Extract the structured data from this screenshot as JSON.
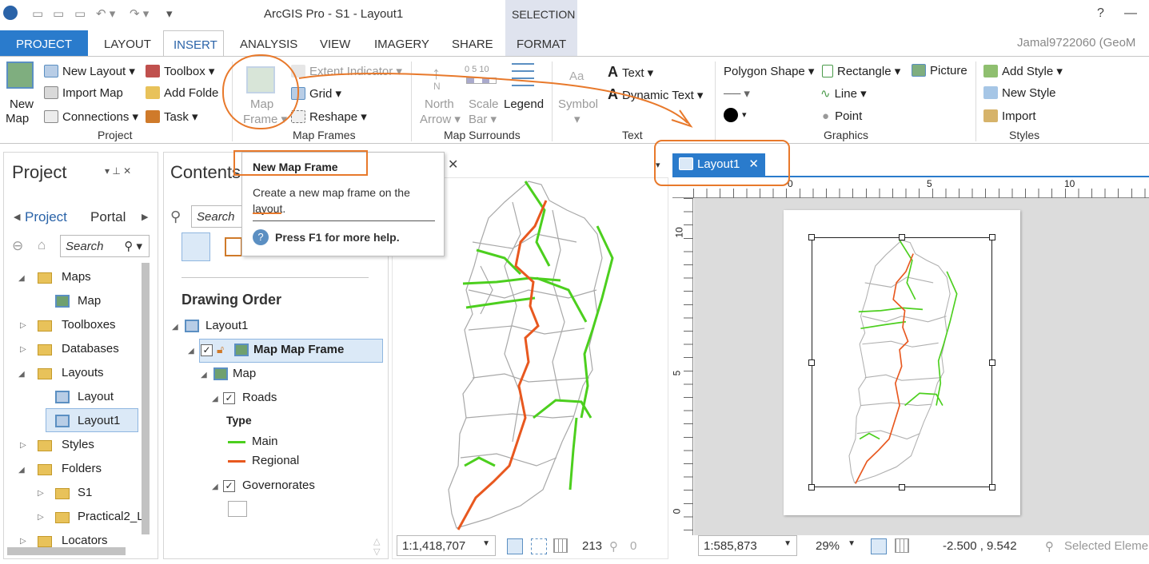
{
  "app": {
    "title": "ArcGIS Pro - S1 - Layout1",
    "contextual_header": "SELECTION",
    "user": "Jamal9722060 (GeoM"
  },
  "tabs": [
    "PROJECT",
    "LAYOUT",
    "INSERT",
    "ANALYSIS",
    "VIEW",
    "IMAGERY",
    "SHARE",
    "FORMAT"
  ],
  "ribbon": {
    "project": {
      "new_map": "New",
      "new_map2": "Map",
      "new_layout": "New Layout",
      "import_map": "Import Map",
      "connections": "Connections",
      "toolbox": "Toolbox",
      "add_folder": "Add Folde",
      "task": "Task",
      "group": "Project"
    },
    "map_frames": {
      "map_frame": "Map",
      "map_frame2": "Frame",
      "extent_indicator": "Extent Indicator",
      "grid": "Grid",
      "reshape": "Reshape",
      "group": "Map Frames"
    },
    "map_surrounds": {
      "north": "North",
      "north2": "Arrow",
      "scale": "Scale",
      "scale2": "Bar",
      "legend": "Legend",
      "scale_nums": "0 5 10",
      "group": "Map Surrounds"
    },
    "text": {
      "aa": "Aa",
      "symbol": "Symbol",
      "text": "Text",
      "dynamic_text": "Dynamic Text",
      "group": "Text"
    },
    "graphics": {
      "polygon_shape": "Polygon Shape",
      "rectangle": "Rectangle",
      "picture": "Picture",
      "line": "Line",
      "point": "Point",
      "group": "Graphics"
    },
    "styles": {
      "add_style": "Add Style",
      "new_style": "New Style",
      "import": "Import",
      "group": "Styles"
    }
  },
  "project_pane": {
    "title": "Project",
    "tabs": [
      "Project",
      "Portal"
    ],
    "search_placeholder": "Search",
    "items": [
      {
        "label": "Maps"
      },
      {
        "label": "Map"
      },
      {
        "label": "Toolboxes"
      },
      {
        "label": "Databases"
      },
      {
        "label": "Layouts"
      },
      {
        "label": "Layout"
      },
      {
        "label": "Layout1"
      },
      {
        "label": "Styles"
      },
      {
        "label": "Folders"
      },
      {
        "label": "S1"
      },
      {
        "label": "Practical2_L"
      },
      {
        "label": "Locators"
      }
    ]
  },
  "contents_pane": {
    "title": "Contents",
    "search_placeholder": "Search",
    "drawing_order": "Drawing Order",
    "items": {
      "layout1": "Layout1",
      "map_frame": "Map Map Frame",
      "map": "Map",
      "roads": "Roads",
      "type": "Type",
      "main": "Main",
      "regional": "Regional",
      "governorates": "Governorates"
    }
  },
  "tooltip": {
    "title": "New Map Frame",
    "body": "Create a new map frame on the layout.",
    "help": "Press F1 for more help."
  },
  "map_view": {
    "scale": "1:1,418,707",
    "coord_trunc": "213",
    "count": "0"
  },
  "layout_view": {
    "tab": "Layout1",
    "ruler_h": [
      "0",
      "5",
      "10"
    ],
    "ruler_v": [
      "10",
      "5",
      "0"
    ],
    "scale": "1:585,873",
    "zoom": "29%",
    "coords": "-2.500 , 9.542",
    "selected": "Selected Eleme"
  },
  "colors": {
    "accent": "#2a7bcc",
    "main_road": "#4ccf1e",
    "regional_road": "#e8581f",
    "annotation": "#e8792b",
    "boundary": "#a8a8a8"
  }
}
